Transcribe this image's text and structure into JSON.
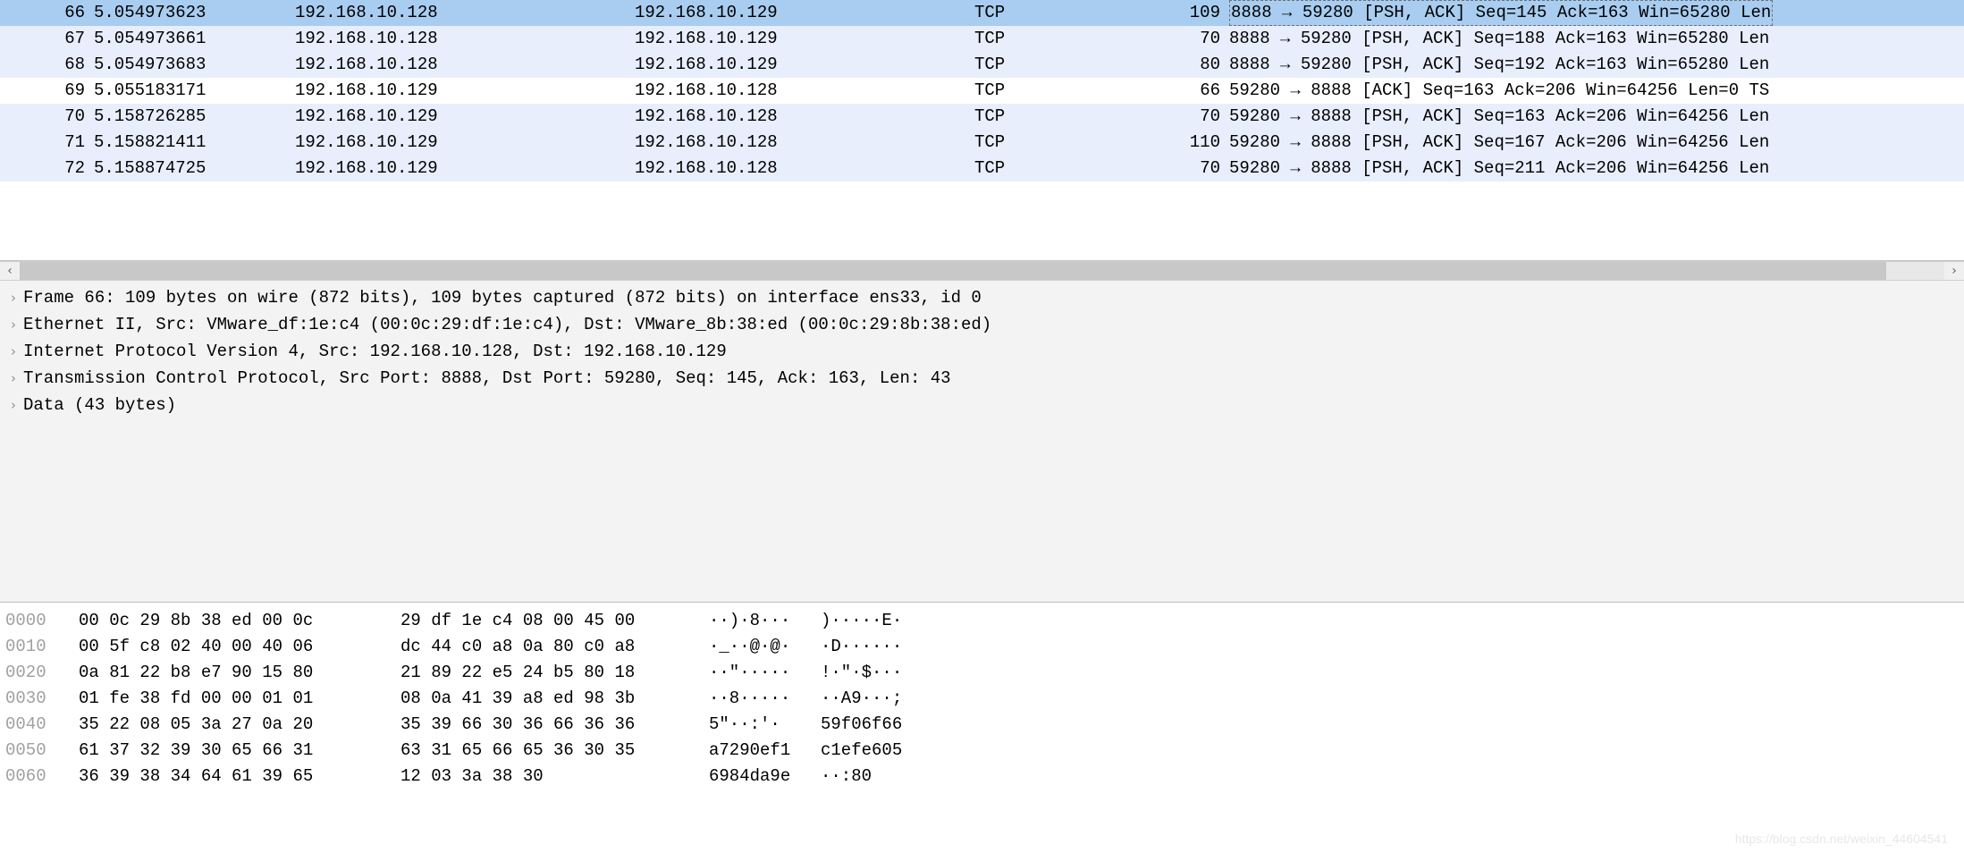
{
  "packets": [
    {
      "no": "66",
      "time": "5.054973623",
      "src": "192.168.10.128",
      "dst": "192.168.10.129",
      "proto": "TCP",
      "len": "109",
      "info": "8888 → 59280 [PSH, ACK] Seq=145 Ack=163 Win=65280 Len",
      "cls": "selected",
      "dashed": true
    },
    {
      "no": "67",
      "time": "5.054973661",
      "src": "192.168.10.128",
      "dst": "192.168.10.129",
      "proto": "TCP",
      "len": "70",
      "info": "8888 → 59280 [PSH, ACK] Seq=188 Ack=163 Win=65280 Len",
      "cls": "light",
      "dashed": false
    },
    {
      "no": "68",
      "time": "5.054973683",
      "src": "192.168.10.128",
      "dst": "192.168.10.129",
      "proto": "TCP",
      "len": "80",
      "info": "8888 → 59280 [PSH, ACK] Seq=192 Ack=163 Win=65280 Len",
      "cls": "light",
      "dashed": false
    },
    {
      "no": "69",
      "time": "5.055183171",
      "src": "192.168.10.129",
      "dst": "192.168.10.128",
      "proto": "TCP",
      "len": "66",
      "info": "59280 → 8888 [ACK] Seq=163 Ack=206 Win=64256 Len=0 TS",
      "cls": "white",
      "dashed": false
    },
    {
      "no": "70",
      "time": "5.158726285",
      "src": "192.168.10.129",
      "dst": "192.168.10.128",
      "proto": "TCP",
      "len": "70",
      "info": "59280 → 8888 [PSH, ACK] Seq=163 Ack=206 Win=64256 Len",
      "cls": "light",
      "dashed": false
    },
    {
      "no": "71",
      "time": "5.158821411",
      "src": "192.168.10.129",
      "dst": "192.168.10.128",
      "proto": "TCP",
      "len": "110",
      "info": "59280 → 8888 [PSH, ACK] Seq=167 Ack=206 Win=64256 Len",
      "cls": "light",
      "dashed": false
    },
    {
      "no": "72",
      "time": "5.158874725",
      "src": "192.168.10.129",
      "dst": "192.168.10.128",
      "proto": "TCP",
      "len": "70",
      "info": "59280 → 8888 [PSH, ACK] Seq=211 Ack=206 Win=64256 Len",
      "cls": "light",
      "dashed": false
    }
  ],
  "details": [
    "Frame 66: 109 bytes on wire (872 bits), 109 bytes captured (872 bits) on interface ens33, id 0",
    "Ethernet II, Src: VMware_df:1e:c4 (00:0c:29:df:1e:c4), Dst: VMware_8b:38:ed (00:0c:29:8b:38:ed)",
    "Internet Protocol Version 4, Src: 192.168.10.128, Dst: 192.168.10.129",
    "Transmission Control Protocol, Src Port: 8888, Dst Port: 59280, Seq: 145, Ack: 163, Len: 43",
    "Data (43 bytes)"
  ],
  "hex": [
    {
      "o": "0000",
      "b1": "00 0c 29 8b 38 ed 00 0c",
      "b2": "29 df 1e c4 08 00 45 00",
      "a1": "··)·8···",
      "a2": ")·····E·"
    },
    {
      "o": "0010",
      "b1": "00 5f c8 02 40 00 40 06",
      "b2": "dc 44 c0 a8 0a 80 c0 a8",
      "a1": "·_··@·@·",
      "a2": "·D······"
    },
    {
      "o": "0020",
      "b1": "0a 81 22 b8 e7 90 15 80",
      "b2": "21 89 22 e5 24 b5 80 18",
      "a1": "··\"·····",
      "a2": "!·\"·$···"
    },
    {
      "o": "0030",
      "b1": "01 fe 38 fd 00 00 01 01",
      "b2": "08 0a 41 39 a8 ed 98 3b",
      "a1": "··8·····",
      "a2": "··A9···;"
    },
    {
      "o": "0040",
      "b1": "35 22 08 05 3a 27 0a 20",
      "b2": "35 39 66 30 36 66 36 36",
      "a1": "5\"··:'· ",
      "a2": "59f06f66"
    },
    {
      "o": "0050",
      "b1": "61 37 32 39 30 65 66 31",
      "b2": "63 31 65 66 65 36 30 35",
      "a1": "a7290ef1",
      "a2": "c1efe605"
    },
    {
      "o": "0060",
      "b1": "36 39 38 34 64 61 39 65",
      "b2": "12 03 3a 38 30",
      "a1": "6984da9e",
      "a2": "··:80"
    }
  ],
  "scroll": {
    "left_arrow": "‹",
    "right_arrow": "›"
  },
  "watermark": "https://blog.csdn.net/weixin_44604541"
}
